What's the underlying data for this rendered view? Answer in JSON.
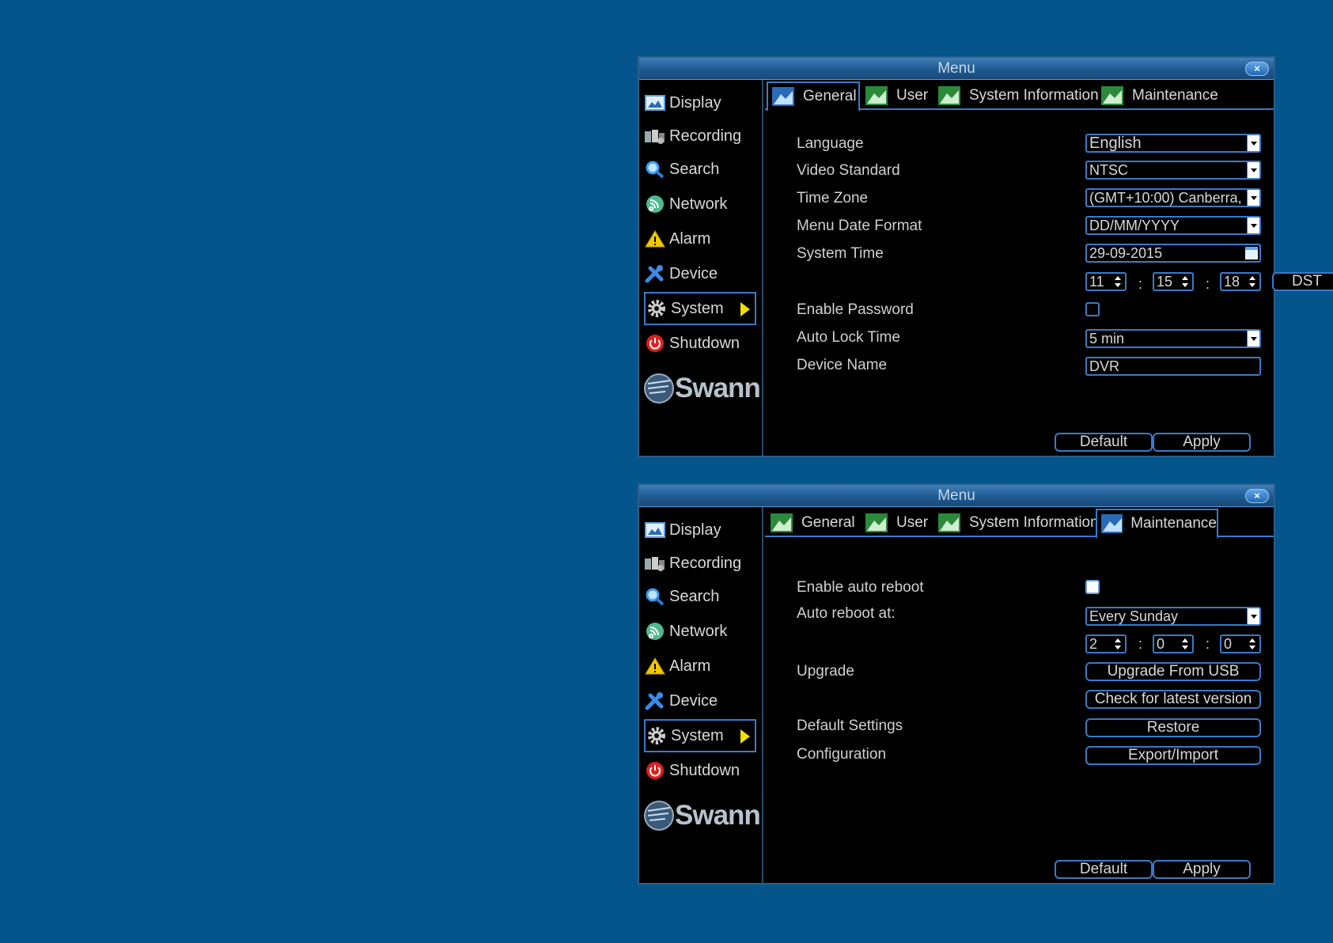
{
  "window1": {
    "title": "Menu",
    "close": "×",
    "nav": [
      {
        "label": "Display",
        "icon": "display-icon"
      },
      {
        "label": "Recording",
        "icon": "recording-icon"
      },
      {
        "label": "Search",
        "icon": "search-icon"
      },
      {
        "label": "Network",
        "icon": "network-icon"
      },
      {
        "label": "Alarm",
        "icon": "alarm-icon"
      },
      {
        "label": "Device",
        "icon": "device-icon"
      },
      {
        "label": "System",
        "icon": "gear-icon",
        "active": true
      },
      {
        "label": "Shutdown",
        "icon": "power-icon"
      }
    ],
    "logo": "Swann",
    "tabs": [
      "General",
      "User",
      "System Information",
      "Maintenance"
    ],
    "active_tab": "General",
    "general": {
      "language_label": "Language",
      "language_value": "English",
      "video_standard_label": "Video Standard",
      "video_standard_value": "NTSC",
      "time_zone_label": "Time Zone",
      "time_zone_value": "(GMT+10:00) Canberra,",
      "date_format_label": "Menu Date Format",
      "date_format_value": "DD/MM/YYYY",
      "system_time_label": "System Time",
      "system_date_value": "29-09-2015",
      "hour": "11",
      "minute": "15",
      "second": "18",
      "colon": ":",
      "dst_label": "DST",
      "enable_password_label": "Enable Password",
      "enable_password_checked": false,
      "auto_lock_label": "Auto Lock Time",
      "auto_lock_value": "5 min",
      "device_name_label": "Device Name",
      "device_name_value": "DVR"
    },
    "default_label": "Default",
    "apply_label": "Apply"
  },
  "window2": {
    "title": "Menu",
    "close": "×",
    "logo": "Swann",
    "active_tab": "Maintenance",
    "maintenance": {
      "auto_reboot_label": "Enable auto reboot",
      "auto_reboot_checked": false,
      "reboot_at_label": "Auto reboot at:",
      "reboot_at_value": "Every Sunday",
      "hour": "2",
      "minute": "0",
      "second": "0",
      "colon": ":",
      "upgrade_label": "Upgrade",
      "upgrade_usb_label": "Upgrade From USB",
      "check_latest_label": "Check for latest version",
      "default_settings_label": "Default Settings",
      "restore_label": "Restore",
      "configuration_label": "Configuration",
      "export_import_label": "Export/Import"
    },
    "default_label": "Default",
    "apply_label": "Apply"
  },
  "colors": {
    "background": "#03558c",
    "accent": "#3a7ac8",
    "titlebar": "#1f5a90",
    "arrow": "#f0e000"
  }
}
